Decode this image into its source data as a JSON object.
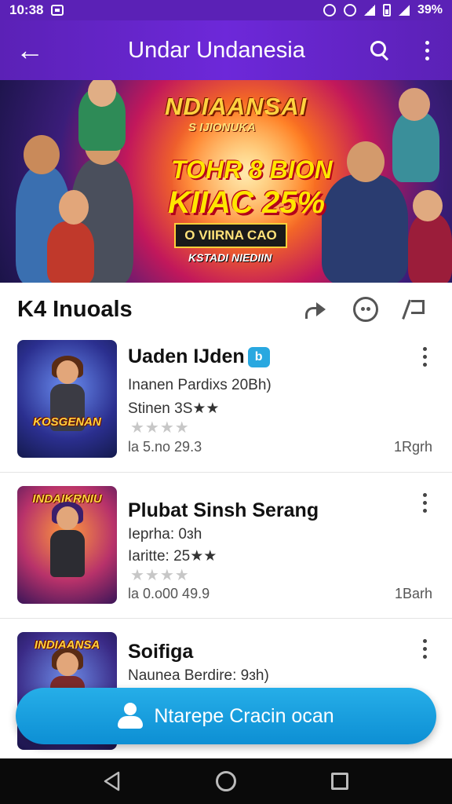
{
  "status_bar": {
    "time": "10:38",
    "battery": "39%"
  },
  "app_bar": {
    "title": "Undar Undanesia",
    "back_icon": "arrow-left-icon",
    "search_icon": "search-icon",
    "more_icon": "more-vert-icon"
  },
  "banner": {
    "title": "NDIAANSAI",
    "subtitle": "S IJIONUKA",
    "promo_line1": "TOHR 8 BION",
    "promo_line2": "KIIAC 25%",
    "cta": "O VIIRNA CAO",
    "footer": "KSTADI NIEDIIN"
  },
  "section": {
    "title": "K4 Inuoals",
    "share_icon": "share-icon",
    "face_icon": "emoji-icon",
    "flag_icon": "flag-icon"
  },
  "list": [
    {
      "title": "Uaden IJden",
      "verified_badge": "b",
      "line1": "Inanen Pardixs 20Bh)",
      "line2": "Stinen 3S★★",
      "stars": "★★★★",
      "meta": "la 5.no 29.3",
      "right": "1Rgrh",
      "thumb_label": "KOSGENAN"
    },
    {
      "title": "Plubat Sinsh Serang",
      "line1": "Ieprha: 0ɜh",
      "line2": "Iaritte: 25★★",
      "stars": "★★★★",
      "meta": "la 0.o00 49.9",
      "right": "1Barh",
      "thumb_label": "INDAIKRNIU"
    },
    {
      "title": "Soifiga",
      "line1": "Naunea Berdire: 9ɜh)",
      "thumb_label": "INDIAANSA"
    }
  ],
  "fab": {
    "label": "Ntarepe Cracin ocan",
    "icon": "person-icon"
  },
  "nav": {
    "back_icon": "nav-back-icon",
    "home_icon": "nav-home-icon",
    "recents_icon": "nav-recents-icon"
  },
  "colors": {
    "app_bar": "#5b21b6",
    "fab": "#1ba1e2",
    "nav_bar": "#0a0a0a"
  }
}
